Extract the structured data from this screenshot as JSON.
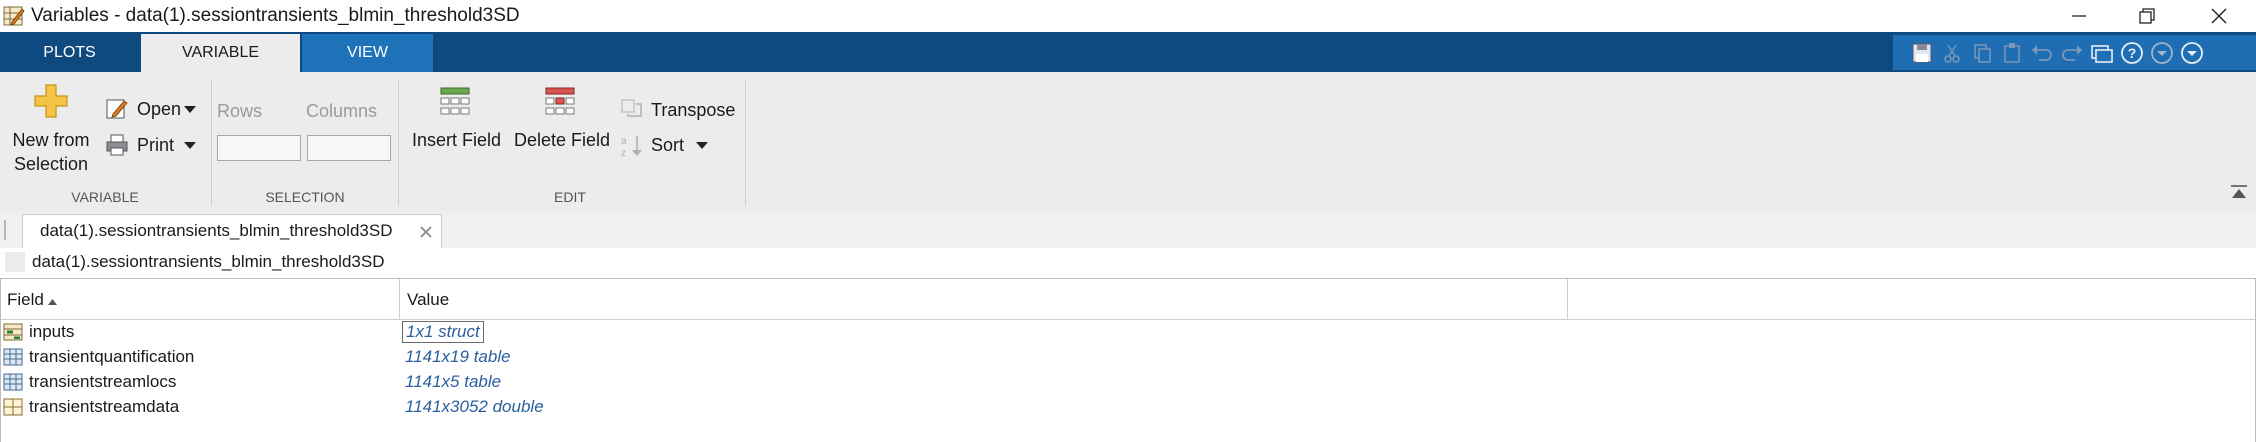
{
  "window": {
    "title": "Variables - data(1).sessiontransients_blmin_threshold3SD"
  },
  "tabs": [
    {
      "label": "PLOTS",
      "active": false
    },
    {
      "label": "VARIABLE",
      "active": true
    },
    {
      "label": "VIEW",
      "active": false
    }
  ],
  "ribbon": {
    "variable": {
      "new_from_selection_line1": "New from",
      "new_from_selection_line2": "Selection",
      "open_label": "Open",
      "print_label": "Print",
      "section_label": "VARIABLE"
    },
    "selection": {
      "rows_label": "Rows",
      "columns_label": "Columns",
      "rows_value": "",
      "columns_value": "",
      "section_label": "SELECTION"
    },
    "edit": {
      "insert_field_label": "Insert Field",
      "delete_field_label": "Delete Field",
      "transpose_label": "Transpose",
      "sort_label": "Sort",
      "section_label": "EDIT"
    }
  },
  "document_tab": {
    "label": "data(1).sessiontransients_blmin_threshold3SD"
  },
  "path": "data(1).sessiontransients_blmin_threshold3SD",
  "table": {
    "columns": [
      "Field",
      "Value"
    ],
    "rows": [
      {
        "field": "inputs",
        "value": "1x1 struct",
        "icon": "struct-icon"
      },
      {
        "field": "transientquantification",
        "value": "1141x19 table",
        "icon": "table-icon"
      },
      {
        "field": "transientstreamlocs",
        "value": "1141x5 table",
        "icon": "table-icon"
      },
      {
        "field": "transientstreamdata",
        "value": "1141x3052 double",
        "icon": "matrix-icon"
      }
    ]
  },
  "colors": {
    "tabbar": "#0e4a80",
    "active_tab": "#ececec",
    "view_tab": "#1d72b8",
    "ribbon": "#ececec",
    "value_text": "#2a5f9e"
  }
}
